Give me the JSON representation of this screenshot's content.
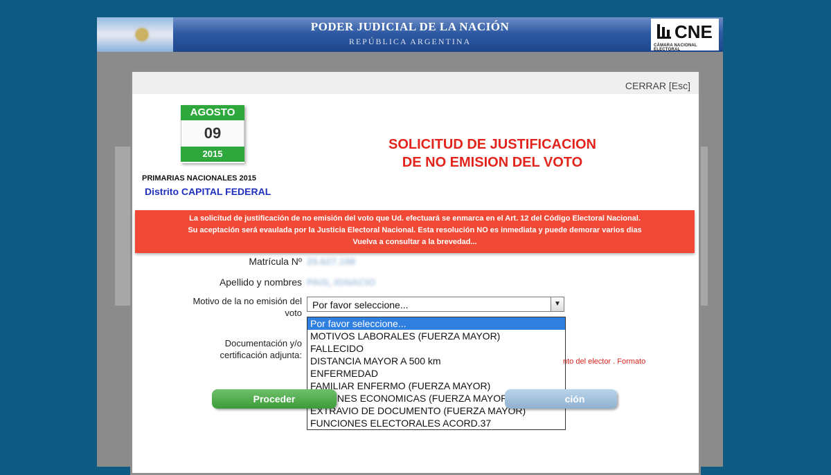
{
  "header": {
    "title": "PODER JUDICIAL DE LA NACIÓN",
    "subtitle": "REPÚBLICA ARGENTINA",
    "logo_text": "CNE",
    "logo_subtext": "CÁMARA NACIONAL ELECTORAL"
  },
  "modal": {
    "close_label": "CERRAR [Esc]",
    "calendar": {
      "month": "AGOSTO",
      "day": "09",
      "year": "2015"
    },
    "election": "PRIMARIAS NACIONALES 2015",
    "district": "Distrito CAPITAL FEDERAL",
    "title_line1": "SOLICITUD DE JUSTIFICACION",
    "title_line2": "DE NO EMISION DEL VOTO",
    "banner": [
      "La solicitud de justificación de no emisión del voto que Ud. efectuará se enmarca en el Art. 12 del Código Electoral Nacional.",
      "Su aceptación será evaulada por la Justicia Electoral Nacional. Esta resolución NO es inmediata y puede demorar varios dias",
      "Vuelva a consultar a la brevedad..."
    ],
    "form": {
      "matricula_label": "Matrícula Nº",
      "matricula_value": "25.627.198",
      "apellido_label": "Apellido y nombres",
      "apellido_value": "PAIS, IGNACIO",
      "motivo_label_1": "Motivo de la no emisión del",
      "motivo_label_2": "voto",
      "motivo_selected": "Por favor seleccione...",
      "motivo_options": [
        "Por favor seleccione...",
        "MOTIVOS LABORALES (FUERZA MAYOR)",
        "FALLECIDO",
        "DISTANCIA MAYOR A 500 km",
        "ENFERMEDAD",
        "FAMILIAR ENFERMO (FUERZA MAYOR)",
        "RAZONES ECONOMICAS (FUERZA MAYOR)",
        "EXTRAVIO DE DOCUMENTO (FUERZA MAYOR)",
        "FUNCIONES ELECTORALES ACORD.37"
      ],
      "doc_label_1": "Documentación y/o",
      "doc_label_2": "certificación adjunta:",
      "doc_note": "nto del elector . Formato"
    },
    "buttons": {
      "proceed": "Proceder",
      "cancel_partial": "ción"
    }
  }
}
